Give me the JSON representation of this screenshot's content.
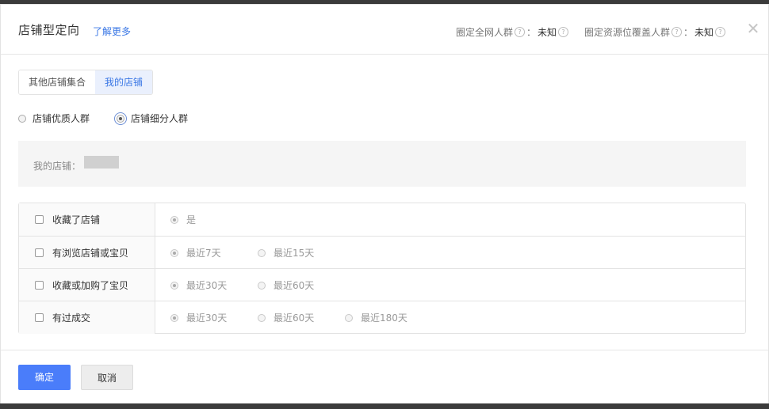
{
  "header": {
    "title": "店铺型定向",
    "learn_more": "了解更多",
    "metrics": [
      {
        "label": "圈定全网人群",
        "value": "未知"
      },
      {
        "label": "圈定资源位覆盖人群",
        "value": "未知"
      }
    ]
  },
  "tabs": [
    {
      "label": "其他店铺集合",
      "active": false
    },
    {
      "label": "我的店铺",
      "active": true
    }
  ],
  "audience_type": {
    "options": [
      "店铺优质人群",
      "店铺细分人群"
    ],
    "selected": "店铺细分人群"
  },
  "shop": {
    "label": "我的店铺："
  },
  "criteria": [
    {
      "label": "收藏了店铺",
      "checked": false,
      "options": [
        "是"
      ],
      "selected": "是"
    },
    {
      "label": "有浏览店铺或宝贝",
      "checked": false,
      "options": [
        "最近7天",
        "最近15天"
      ],
      "selected": "最近7天"
    },
    {
      "label": "收藏或加购了宝贝",
      "checked": false,
      "options": [
        "最近30天",
        "最近60天"
      ],
      "selected": "最近30天"
    },
    {
      "label": "有过成交",
      "checked": false,
      "options": [
        "最近30天",
        "最近60天",
        "最近180天"
      ],
      "selected": "最近30天"
    }
  ],
  "footer": {
    "confirm": "确定",
    "cancel": "取消"
  },
  "colors": {
    "accent": "#3a77e5",
    "primary_button": "#4a7dfa"
  }
}
